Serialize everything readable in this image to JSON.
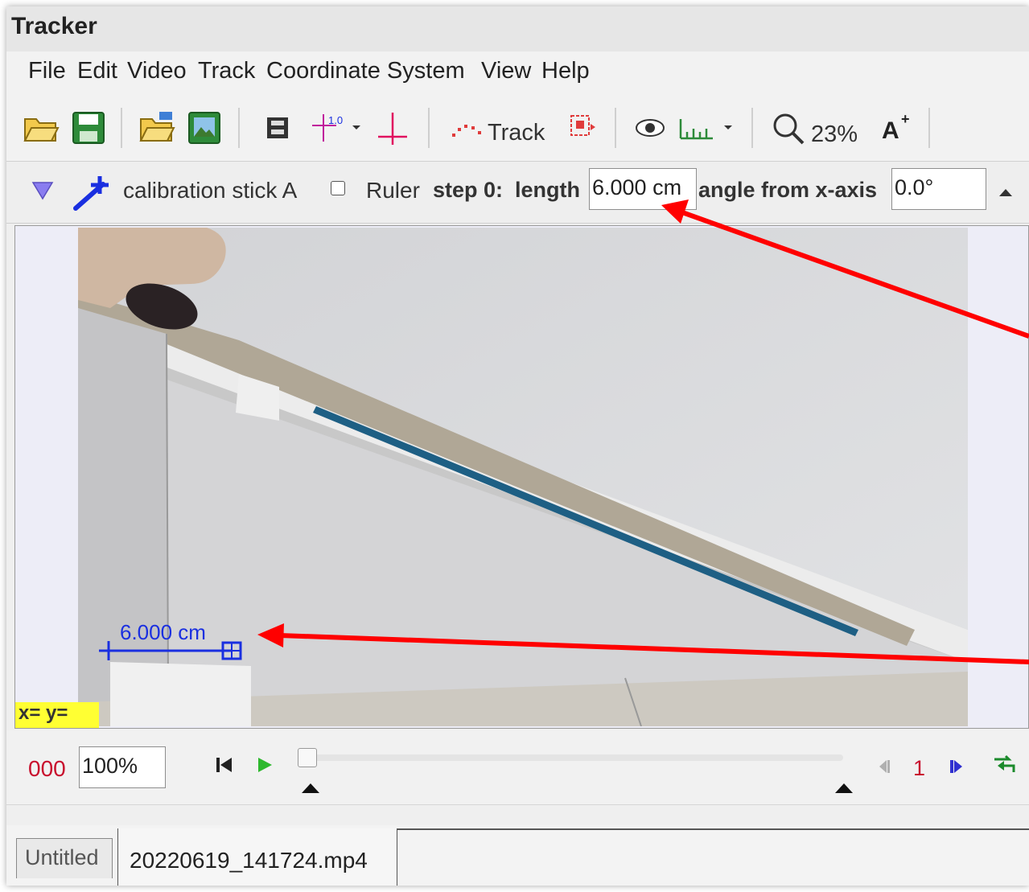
{
  "window": {
    "title": "Tracker"
  },
  "menu": [
    "File",
    "Edit",
    "Video",
    "Track",
    "Coordinate System",
    "View",
    "Help"
  ],
  "toolbar": {
    "track_label": "Track",
    "zoom": "23%"
  },
  "trackbar": {
    "track_name": "calibration stick A",
    "ruler_label": "Ruler",
    "step_label": "step 0:",
    "length_label": "length",
    "length_value": "6.000 cm",
    "angle_label": "angle from x-axis",
    "angle_value": "0.0°"
  },
  "viewport": {
    "stick_label": "6.000 cm",
    "coords_text": "x=  y="
  },
  "player": {
    "frame_counter": "000",
    "rate_value": "100%",
    "step_size": "1"
  },
  "tabs": [
    {
      "label": "Untitled"
    },
    {
      "label": "20220619_141724.mp4"
    }
  ],
  "colors": {
    "annotation_arrow": "#ff0000",
    "stick": "#1a2fe0",
    "coords_bg": "#ffff33"
  }
}
